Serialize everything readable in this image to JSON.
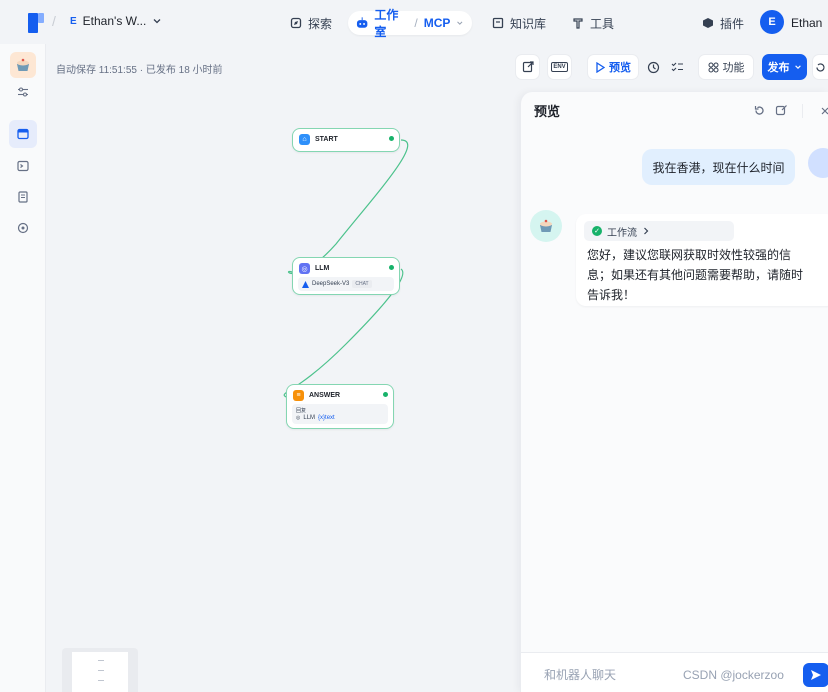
{
  "nav": {
    "workspace_badge": "E",
    "workspace_name": "Ethan's W...",
    "explore": "探索",
    "studio": "工作室",
    "studio_sep": "/",
    "mcp": "MCP",
    "knowledge": "知识库",
    "tools": "工具",
    "plugins": "插件",
    "user_initial": "E",
    "user_name": "Ethan"
  },
  "editor": {
    "autosave": "自动保存 11:51:55 · 已发布 18 小时前",
    "env_label": "ENV",
    "preview_label": "预览",
    "features_label": "功能",
    "publish_label": "发布"
  },
  "nodes": {
    "start": {
      "title": "START"
    },
    "llm": {
      "title": "LLM",
      "model": "DeepSeek-V3",
      "mode": "CHAT"
    },
    "answer": {
      "title": "ANSWER",
      "field": "回复",
      "var_source": "LLM",
      "var_name": "{x}text"
    }
  },
  "preview": {
    "title": "预览",
    "user_message": "我在香港，现在什么时间",
    "workflow_tag": "工作流",
    "bot_reply": "您好，建议您联网获取时效性较强的信息；如果还有其他问题需要帮助，请随时告诉我！",
    "input_placeholder": "和机器人聊天"
  },
  "watermark": "CSDN @jockerzoo",
  "colors": {
    "accent": "#155eef",
    "node_border": "#84d6b2",
    "edge": "#4cc28c",
    "success": "#17b26a",
    "answer_icon": "#f79009",
    "llm_icon": "#6172f3"
  }
}
